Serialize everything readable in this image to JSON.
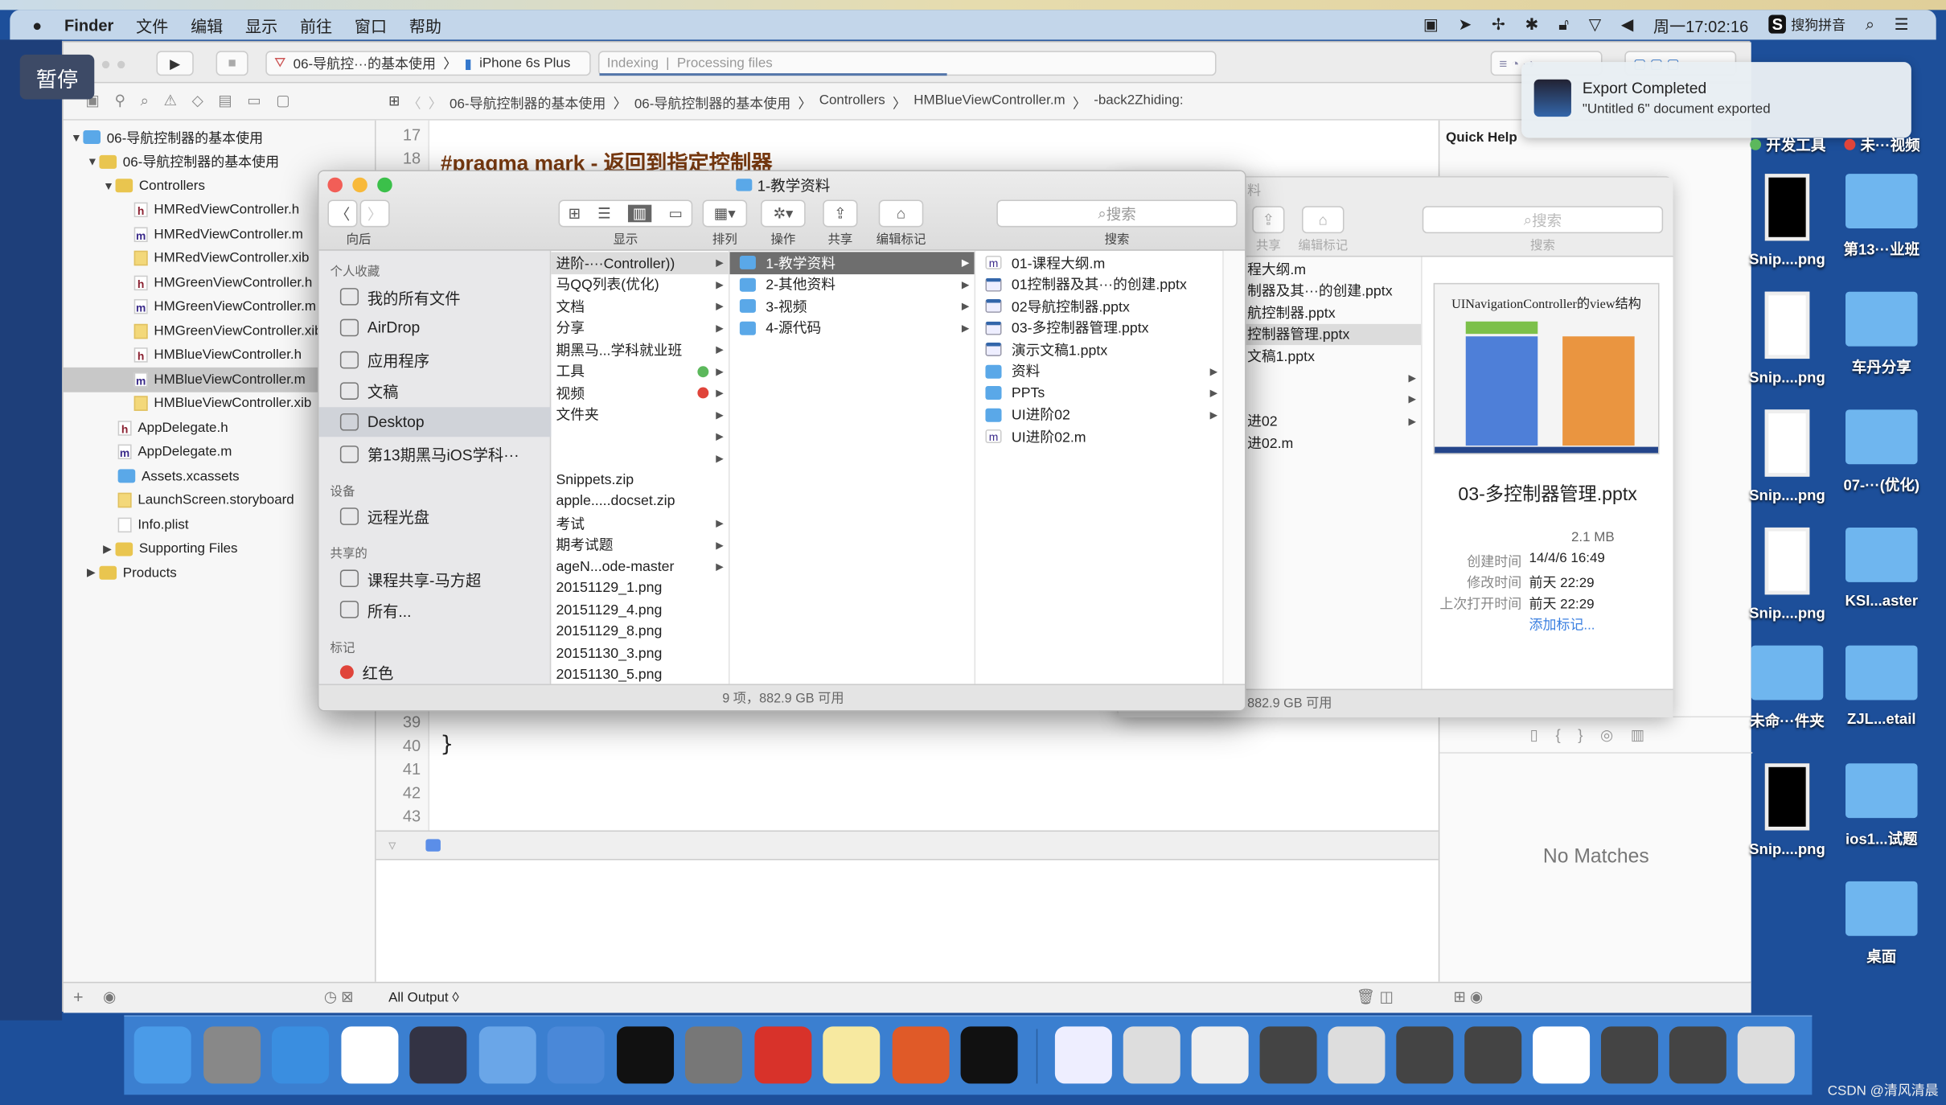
{
  "menubar": {
    "app": "Finder",
    "items": [
      "文件",
      "编辑",
      "显示",
      "前往",
      "窗口",
      "帮助"
    ],
    "clock": "周一17:02:16",
    "ime": "搜狗拼音"
  },
  "overlay": {
    "pause": "暂停"
  },
  "notification": {
    "title": "Export Completed",
    "body": "\"Untitled 6\" document exported"
  },
  "xcode": {
    "scheme": "06-导航控···的基本使用",
    "device": "iPhone 6s Plus",
    "activity_left": "Indexing",
    "activity_right": "Processing files",
    "jumpbar": [
      "06-导航控制器的基本使用",
      "06-导航控制器的基本使用",
      "Controllers",
      "HMBlueViewController.m",
      "-back2Zhiding:"
    ],
    "navigator": [
      {
        "label": "06-导航控制器的基本使用",
        "level": 0,
        "kind": "proj",
        "open": true
      },
      {
        "label": "06-导航控制器的基本使用",
        "level": 1,
        "kind": "folder",
        "open": true
      },
      {
        "label": "Controllers",
        "level": 2,
        "kind": "folder",
        "open": true
      },
      {
        "label": "HMRedViewController.h",
        "level": 3,
        "kind": "h"
      },
      {
        "label": "HMRedViewController.m",
        "level": 3,
        "kind": "m"
      },
      {
        "label": "HMRedViewController.xib",
        "level": 3,
        "kind": "x"
      },
      {
        "label": "HMGreenViewController.h",
        "level": 3,
        "kind": "h"
      },
      {
        "label": "HMGreenViewController.m",
        "level": 3,
        "kind": "m"
      },
      {
        "label": "HMGreenViewController.xib",
        "level": 3,
        "kind": "x"
      },
      {
        "label": "HMBlueViewController.h",
        "level": 3,
        "kind": "h"
      },
      {
        "label": "HMBlueViewController.m",
        "level": 3,
        "kind": "m",
        "selected": true
      },
      {
        "label": "HMBlueViewController.xib",
        "level": 3,
        "kind": "x"
      },
      {
        "label": "AppDelegate.h",
        "level": 2,
        "kind": "h"
      },
      {
        "label": "AppDelegate.m",
        "level": 2,
        "kind": "m"
      },
      {
        "label": "Assets.xcassets",
        "level": 2,
        "kind": "assets"
      },
      {
        "label": "LaunchScreen.storyboard",
        "level": 2,
        "kind": "x"
      },
      {
        "label": "Info.plist",
        "level": 2,
        "kind": "plist"
      },
      {
        "label": "Supporting Files",
        "level": 2,
        "kind": "folder",
        "open": false
      },
      {
        "label": "Products",
        "level": 1,
        "kind": "folder",
        "open": false
      }
    ],
    "code_top": [
      {
        "n": "17",
        "text": ""
      },
      {
        "n": "18",
        "text": "#pragma mark - 返回到指定控制器"
      }
    ],
    "code_bottom": [
      {
        "n": "39",
        "text": ""
      },
      {
        "n": "40",
        "text": "}"
      },
      {
        "n": "41",
        "text": ""
      },
      {
        "n": "42",
        "text": ""
      },
      {
        "n": "43",
        "text": ""
      }
    ],
    "console_filter": "All Output ◊",
    "quick_help": "Quick Help",
    "library_empty": "No Matches"
  },
  "finder": {
    "title": "1-教学资料",
    "toolbar": {
      "back": "向后",
      "view": "显示",
      "arrange": "排列",
      "action": "操作",
      "share": "共享",
      "tags": "编辑标记",
      "search": "搜索",
      "search_placeholder": "搜索"
    },
    "sidebar": [
      {
        "head": "个人收藏"
      },
      {
        "label": "我的所有文件"
      },
      {
        "label": "AirDrop"
      },
      {
        "label": "应用程序"
      },
      {
        "label": "文稿"
      },
      {
        "label": "Desktop",
        "selected": true
      },
      {
        "label": "第13期黑马iOS学科···"
      },
      {
        "head": "设备"
      },
      {
        "label": "远程光盘"
      },
      {
        "head": "共享的"
      },
      {
        "label": "课程共享-马方超"
      },
      {
        "label": "所有..."
      },
      {
        "head": "标记"
      },
      {
        "label": "红色",
        "tag": "#e0443a"
      }
    ],
    "col1": [
      {
        "label": "进阶-···Controller))",
        "arrow": true,
        "hl": true
      },
      {
        "label": "马QQ列表(优化)",
        "arrow": true
      },
      {
        "label": "文档",
        "arrow": true
      },
      {
        "label": "分享",
        "arrow": true
      },
      {
        "label": "期黑马...学科就业班",
        "arrow": true
      },
      {
        "label": "工具",
        "arrow": true,
        "tag": "#5cb85c"
      },
      {
        "label": "视频",
        "arrow": true,
        "tag": "#e0443a"
      },
      {
        "label": "文件夹",
        "arrow": true
      },
      {
        "label": "",
        "arrow": true
      },
      {
        "label": "",
        "arrow": true
      },
      {
        "label": "Snippets.zip"
      },
      {
        "label": "apple.....docset.zip"
      },
      {
        "label": "考试",
        "arrow": true
      },
      {
        "label": "期考试题",
        "arrow": true
      },
      {
        "label": "ageN...ode-master",
        "arrow": true
      },
      {
        "label": "20151129_1.png"
      },
      {
        "label": "20151129_4.png"
      },
      {
        "label": "20151129_8.png"
      },
      {
        "label": "20151130_3.png"
      },
      {
        "label": "20151130_5.png"
      }
    ],
    "col2": [
      {
        "label": "1-教学资料",
        "arrow": true,
        "selected": true
      },
      {
        "label": "2-其他资料",
        "arrow": true
      },
      {
        "label": "3-视频",
        "arrow": true
      },
      {
        "label": "4-源代码",
        "arrow": true
      }
    ],
    "col3": [
      {
        "label": "01-课程大纲.m",
        "kind": "m"
      },
      {
        "label": "01控制器及其···的创建.pptx",
        "kind": "ppt"
      },
      {
        "label": "02导航控制器.pptx",
        "kind": "ppt"
      },
      {
        "label": "03-多控制器管理.pptx",
        "kind": "ppt"
      },
      {
        "label": "演示文稿1.pptx",
        "kind": "ppt"
      },
      {
        "label": "资料",
        "kind": "folder",
        "arrow": true
      },
      {
        "label": "PPTs",
        "kind": "folder",
        "arrow": true
      },
      {
        "label": "UI进阶02",
        "kind": "folder",
        "arrow": true
      },
      {
        "label": "UI进阶02.m",
        "kind": "m"
      }
    ],
    "status": "9 项，882.9 GB 可用"
  },
  "finder_back": {
    "toolbar": {
      "share": "共享",
      "tags": "编辑标记",
      "search": "搜索",
      "search_placeholder": "搜索"
    },
    "title_fragment": "料",
    "col": [
      {
        "label": "程大纲.m"
      },
      {
        "label": "制器及其···的创建.pptx"
      },
      {
        "label": "航控制器.pptx"
      },
      {
        "label": "控制器管理.pptx",
        "selected": true
      },
      {
        "label": "文稿1.pptx"
      },
      {
        "label": "",
        "arrow": true
      },
      {
        "label": "",
        "arrow": true
      },
      {
        "label": "进02",
        "arrow": true
      },
      {
        "label": "进02.m"
      }
    ],
    "preview": {
      "slide_title": "UINavigationController的view结构",
      "name": "03-多控制器管理.pptx",
      "size": "2.1 MB",
      "meta": [
        {
          "k": "创建时间",
          "v": "14/4/6 16:49"
        },
        {
          "k": "修改时间",
          "v": "前天 22:29"
        },
        {
          "k": "上次打开时间",
          "v": "前天 22:29"
        }
      ],
      "add_tags": "添加标记..."
    },
    "status": "882.9 GB 可用"
  },
  "desktop": {
    "items": [
      {
        "label": "开发工具",
        "tag": "#5cb85c"
      },
      {
        "label": "未···视频",
        "tag": "#e0443a"
      },
      {
        "label": "Snip....png",
        "kind": "thumb"
      },
      {
        "label": "第13···业班",
        "kind": "folder"
      },
      {
        "label": "Snip....png",
        "kind": "thumb"
      },
      {
        "label": "车丹分享",
        "kind": "folder"
      },
      {
        "label": "Snip....png",
        "kind": "thumb"
      },
      {
        "label": "07-···(优化)",
        "kind": "folder"
      },
      {
        "label": "Snip....png",
        "kind": "thumb"
      },
      {
        "label": "KSI...aster",
        "kind": "folder"
      },
      {
        "label": "未命···件夹",
        "kind": "folder"
      },
      {
        "label": "ZJL...etail",
        "kind": "folder"
      },
      {
        "label": "Snip....png",
        "kind": "thumb"
      },
      {
        "label": "ios1...试题",
        "kind": "folder"
      },
      {
        "label": "",
        "kind": "none"
      },
      {
        "label": "桌面",
        "kind": "folder"
      }
    ]
  },
  "dock": {
    "apps": [
      {
        "name": "finder",
        "color": "#4a9be8"
      },
      {
        "name": "launchpad",
        "color": "#888"
      },
      {
        "name": "safari",
        "color": "#3a8ee0"
      },
      {
        "name": "mouse-app",
        "color": "#fff"
      },
      {
        "name": "imovie",
        "color": "#334"
      },
      {
        "name": "xcode",
        "color": "#6aa6e8"
      },
      {
        "name": "instruments",
        "color": "#4a88d8"
      },
      {
        "name": "terminal",
        "color": "#111"
      },
      {
        "name": "system-preferences",
        "color": "#777"
      },
      {
        "name": "xmind",
        "color": "#d8322a"
      },
      {
        "name": "notes",
        "color": "#f7e9a0"
      },
      {
        "name": "powerpoint",
        "color": "#e05a28"
      },
      {
        "name": "console",
        "color": "#111"
      },
      {
        "name": "window-1",
        "color": "#eef"
      },
      {
        "name": "window-2",
        "color": "#ddd"
      },
      {
        "name": "window-3",
        "color": "#eee"
      },
      {
        "name": "window-4",
        "color": "#444"
      },
      {
        "name": "window-5",
        "color": "#ddd"
      },
      {
        "name": "window-6",
        "color": "#444"
      },
      {
        "name": "window-7",
        "color": "#444"
      },
      {
        "name": "window-8",
        "color": "#fff"
      },
      {
        "name": "window-9",
        "color": "#444"
      },
      {
        "name": "window-10",
        "color": "#444"
      },
      {
        "name": "trash",
        "color": "#ddd"
      }
    ]
  },
  "watermark": "CSDN @清风清晨"
}
